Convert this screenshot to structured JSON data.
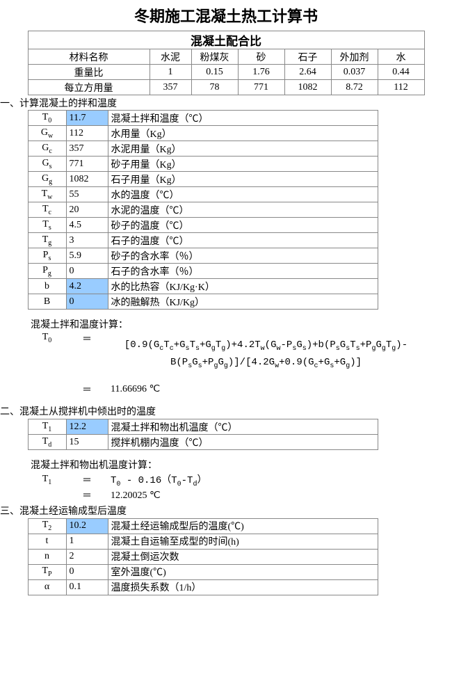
{
  "title": "冬期施工混凝土热工计算书",
  "mix": {
    "subtitle": "混凝土配合比",
    "headers": [
      "材料名称",
      "水泥",
      "粉煤灰",
      "砂",
      "石子",
      "外加剂",
      "水"
    ],
    "row1_label": "重量比",
    "row1": [
      "1",
      "0.15",
      "1.76",
      "2.64",
      "0.037",
      "0.44"
    ],
    "row2_label": "每立方用量",
    "row2": [
      "357",
      "78",
      "771",
      "1082",
      "8.72",
      "112"
    ]
  },
  "sec1": {
    "title": "一、计算混凝土的拌和温度",
    "rows": [
      {
        "sym": "T<sub>0</sub>",
        "val": "11.7",
        "desc": "混凝土拌和温度（℃）",
        "hl": true
      },
      {
        "sym": "G<sub>w</sub>",
        "val": "112",
        "desc": "水用量（Kg）"
      },
      {
        "sym": "G<sub>c</sub>",
        "val": "357",
        "desc": "水泥用量（Kg）"
      },
      {
        "sym": "G<sub>s</sub>",
        "val": "771",
        "desc": "砂子用量（Kg）"
      },
      {
        "sym": "G<sub>g</sub>",
        "val": "1082",
        "desc": "石子用量（Kg）"
      },
      {
        "sym": "T<sub>w</sub>",
        "val": "55",
        "desc": "水的温度（℃）"
      },
      {
        "sym": "T<sub>c</sub>",
        "val": "20",
        "desc": "水泥的温度（℃）"
      },
      {
        "sym": "T<sub>s</sub>",
        "val": "4.5",
        "desc": "砂子的温度（℃）"
      },
      {
        "sym": "T<sub>g</sub>",
        "val": "3",
        "desc": "石子的温度（℃）"
      },
      {
        "sym": "P<sub>s</sub>",
        "val": "5.9",
        "desc": "砂子的含水率（％）"
      },
      {
        "sym": "P<sub>g</sub>",
        "val": "0",
        "desc": "石子的含水率（％）"
      },
      {
        "sym": "b",
        "val": "4.2",
        "desc": "水的比热容（KJ/Kg·K）",
        "hl": true
      },
      {
        "sym": "B",
        "val": "0",
        "desc": "冰的融解热（KJ/Kg）",
        "hl": true
      }
    ],
    "calc_label": "混凝土拌和温度计算：",
    "lhs": "T<sub>0</sub>",
    "eq": "＝",
    "formula": "[0.9(G<sub>c</sub>T<sub>c</sub>+G<sub>s</sub>T<sub>s</sub>+G<sub>g</sub>T<sub>g</sub>)+4.2T<sub>w</sub>(G<sub>w</sub>-P<sub>s</sub>G<sub>s</sub>)+b(P<sub>s</sub>G<sub>s</sub>T<sub>s</sub>+P<sub>g</sub>G<sub>g</sub>T<sub>g</sub>)-B(P<sub>s</sub>G<sub>s</sub>+P<sub>g</sub>G<sub>g</sub>)]/[4.2G<sub>w</sub>+0.9(G<sub>c</sub>+G<sub>s</sub>+G<sub>g</sub>)]",
    "result": "11.66696 ℃"
  },
  "sec2": {
    "title": "二、混凝土从搅拌机中倾出时的温度",
    "rows": [
      {
        "sym": "T<sub>1</sub>",
        "val": "12.2",
        "desc": "混凝土拌和物出机温度（℃）",
        "hl": true
      },
      {
        "sym": "T<sub>d</sub>",
        "val": "15",
        "desc": "搅拌机棚内温度（℃）"
      }
    ],
    "calc_label": "混凝土拌和物出机温度计算：",
    "lhs": "T<sub>1</sub>",
    "eq": "＝",
    "formula": "T<sub>0</sub> - 0.16（T<sub>0</sub>-T<sub>d</sub>）",
    "result": "12.20025 ℃"
  },
  "sec3": {
    "title": "三、混凝土经运输成型后温度",
    "rows": [
      {
        "sym": "T<sub>2</sub>",
        "val": "10.2",
        "desc": "混凝土经运输成型后的温度(℃)",
        "hl": true
      },
      {
        "sym": "t",
        "val": "1",
        "desc": "混凝土自运输至成型的时间(h)"
      },
      {
        "sym": "n",
        "val": "2",
        "desc": "混凝土倒运次数"
      },
      {
        "sym": "T<sub>P</sub>",
        "val": "0",
        "desc": "室外温度(℃)"
      },
      {
        "sym": "α",
        "val": "0.1",
        "desc": "温度损失系数（1/h）"
      }
    ]
  },
  "chart_data": {
    "type": "table",
    "title": "冬期施工混凝土热工计算书",
    "mix_ratio": {
      "materials": [
        "水泥",
        "粉煤灰",
        "砂",
        "石子",
        "外加剂",
        "水"
      ],
      "weight_ratio": [
        1,
        0.15,
        1.76,
        2.64,
        0.037,
        0.44
      ],
      "per_cubic": [
        357,
        78,
        771,
        1082,
        8.72,
        112
      ]
    },
    "inputs": {
      "T0": 11.7,
      "Gw": 112,
      "Gc": 357,
      "Gs": 771,
      "Gg": 1082,
      "Tw": 55,
      "Tc": 20,
      "Ts": 4.5,
      "Tg": 3,
      "Ps": 5.9,
      "Pg": 0,
      "b": 4.2,
      "B": 0,
      "T1": 12.2,
      "Td": 15,
      "T2": 10.2,
      "t": 1,
      "n": 2,
      "Tp": 0,
      "alpha": 0.1
    },
    "results": {
      "T0_calc": 11.66696,
      "T1_calc": 12.20025
    }
  }
}
